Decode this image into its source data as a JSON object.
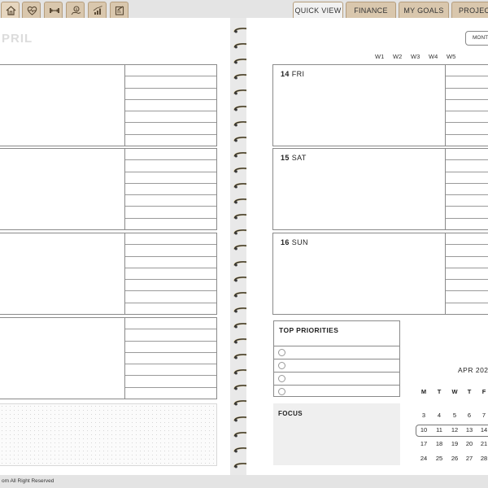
{
  "tabs": {
    "icons": [
      {
        "name": "home-icon",
        "active": true
      },
      {
        "name": "heart-pulse-icon",
        "active": false
      },
      {
        "name": "dumbbell-icon",
        "active": false
      },
      {
        "name": "savings-icon",
        "active": false
      },
      {
        "name": "growth-chart-icon",
        "active": false
      },
      {
        "name": "notes-icon",
        "active": false
      }
    ],
    "nav": [
      {
        "label": "QUICK VIEW",
        "active": true
      },
      {
        "label": "FINANCE",
        "active": false
      },
      {
        "label": "MY GOALS",
        "active": false
      },
      {
        "label": "PROJECT",
        "active": false
      }
    ]
  },
  "left_page": {
    "month_title": "PRIL"
  },
  "right_page": {
    "weeks": [
      "W1",
      "W2",
      "W3",
      "W4",
      "W5"
    ],
    "month_button": "MONT",
    "days": [
      {
        "num": "14",
        "name": "FRI"
      },
      {
        "num": "15",
        "name": "SAT"
      },
      {
        "num": "16",
        "name": "SUN"
      }
    ],
    "priorities_title": "TOP PRIORITIES",
    "focus_title": "FOCUS",
    "mini_calendar": {
      "title": "APR 202",
      "headers": [
        "M",
        "T",
        "W",
        "T",
        "F"
      ],
      "rows": [
        [
          "3",
          "4",
          "5",
          "6",
          "7"
        ],
        [
          "10",
          "11",
          "12",
          "13",
          "14"
        ],
        [
          "17",
          "18",
          "19",
          "20",
          "21"
        ],
        [
          "24",
          "25",
          "26",
          "27",
          "28"
        ]
      ],
      "highlighted_week": "10-14"
    }
  },
  "footer": {
    "text": "om  All Right Reserved"
  },
  "colors": {
    "tab": "#d9c7ad",
    "active_tab": "#f1f1f1",
    "spiral": "#2a2a2a"
  }
}
